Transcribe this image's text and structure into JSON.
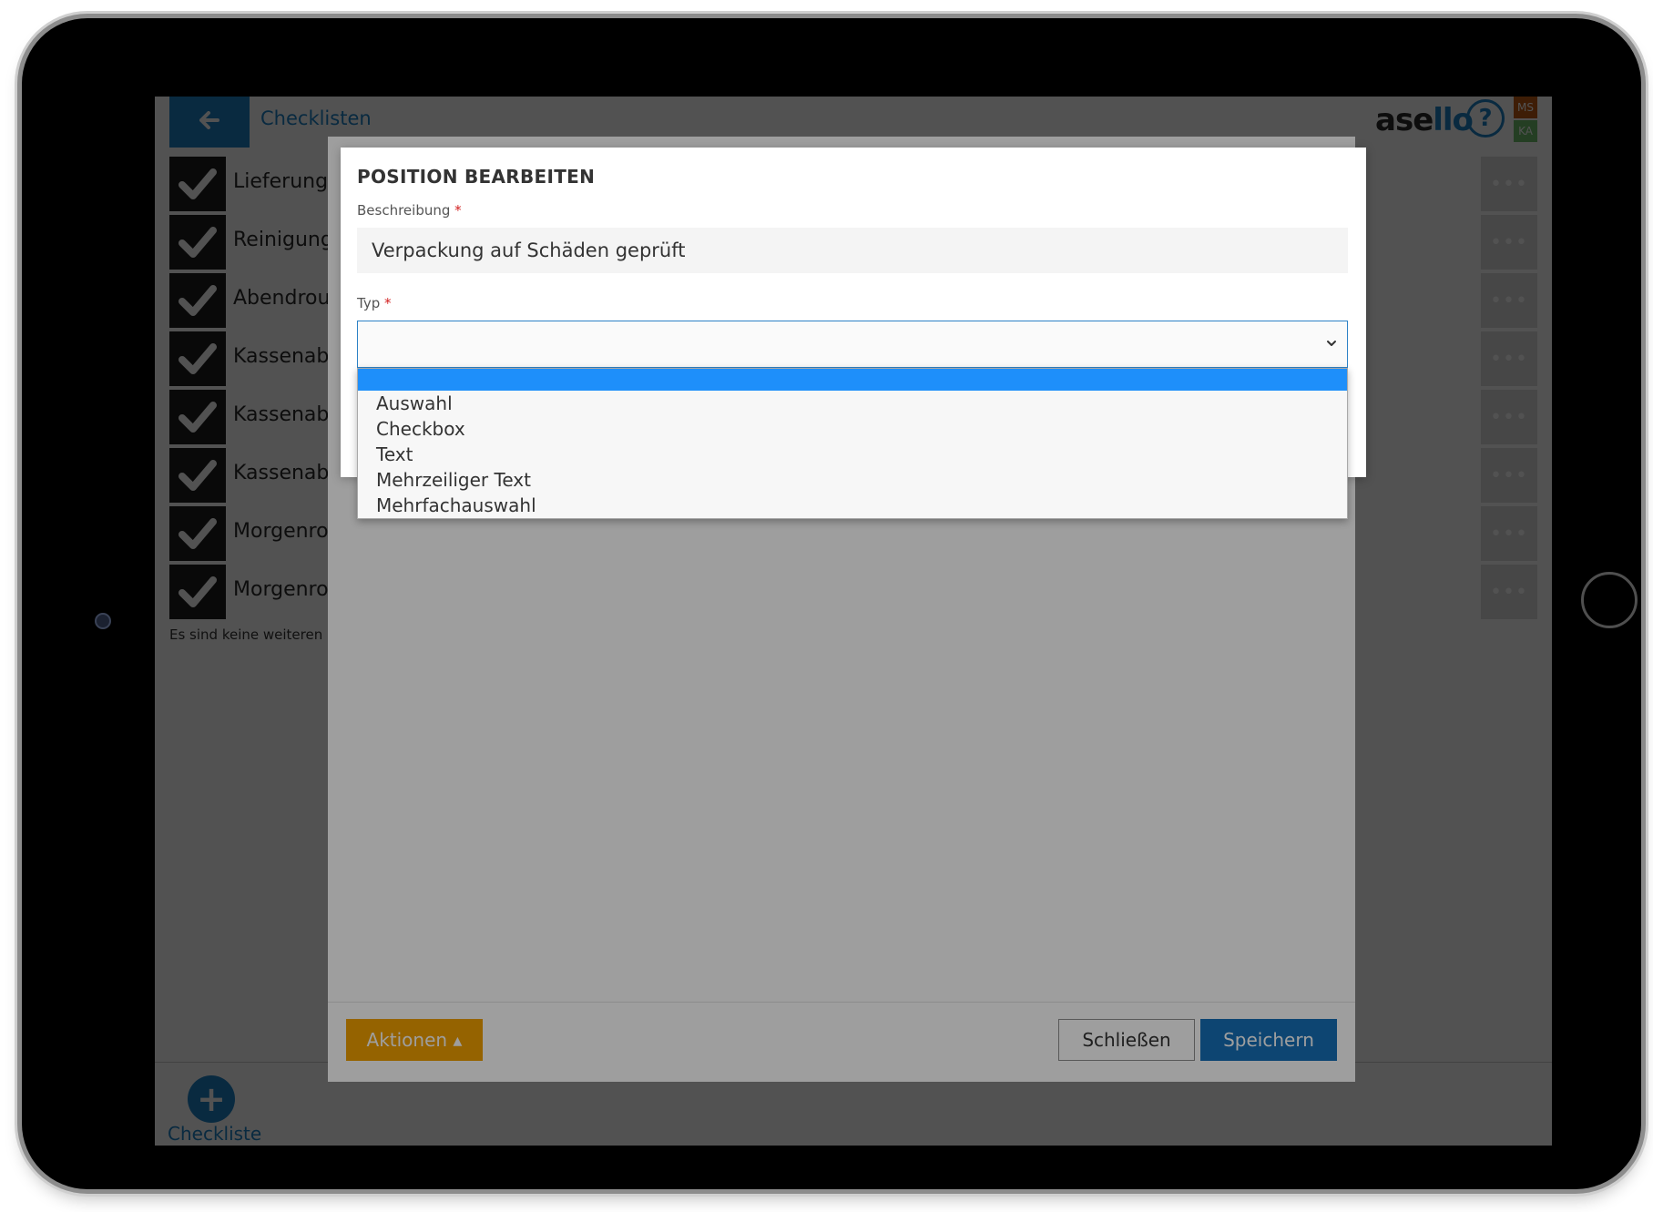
{
  "header": {
    "title": "Checklisten",
    "brand_prefix": "as",
    "brand_mid": "e",
    "brand_suffix": "llo",
    "user_badges": [
      "MS",
      "KA"
    ],
    "help_symbol": "?"
  },
  "list": {
    "items": [
      {
        "label": "Lieferung A"
      },
      {
        "label": "Reinigung"
      },
      {
        "label": "Abendrouti"
      },
      {
        "label": "Kassenabsc"
      },
      {
        "label": "Kassenabsc"
      },
      {
        "label": "Kassenabsc"
      },
      {
        "label": "Morgenrou"
      },
      {
        "label": "Morgenrou"
      }
    ],
    "more_symbol": "•••",
    "empty_note": "Es sind keine weiteren Ei"
  },
  "footer": {
    "add_label": "Checkliste",
    "add_symbol": "+"
  },
  "back_modal": {
    "actions_label": "Aktionen ▴",
    "close_label": "Schließen",
    "save_label": "Speichern"
  },
  "front_modal": {
    "title": "POSITION BEARBEITEN",
    "description_label": "Beschreibung",
    "description_value": "Verpackung auf Schäden geprüft",
    "type_label": "Typ",
    "required_mark": "*",
    "type_value": ""
  },
  "dropdown": {
    "options": [
      "",
      "Auswahl",
      "Checkbox",
      "Text",
      "Mehrzeiliger Text",
      "Mehrfachauswahl"
    ],
    "selected_index": 0
  },
  "colors": {
    "accent": "#1d82c8",
    "actions": "#f0a000",
    "save": "#1670b8",
    "highlight": "#1e8ffa",
    "required": "#d21f1f"
  },
  "icons": {
    "back": "arrow-left-icon",
    "check": "checkmark-icon",
    "help": "question-circle-icon",
    "add": "plus-circle-icon",
    "chevron": "chevron-down-icon"
  }
}
